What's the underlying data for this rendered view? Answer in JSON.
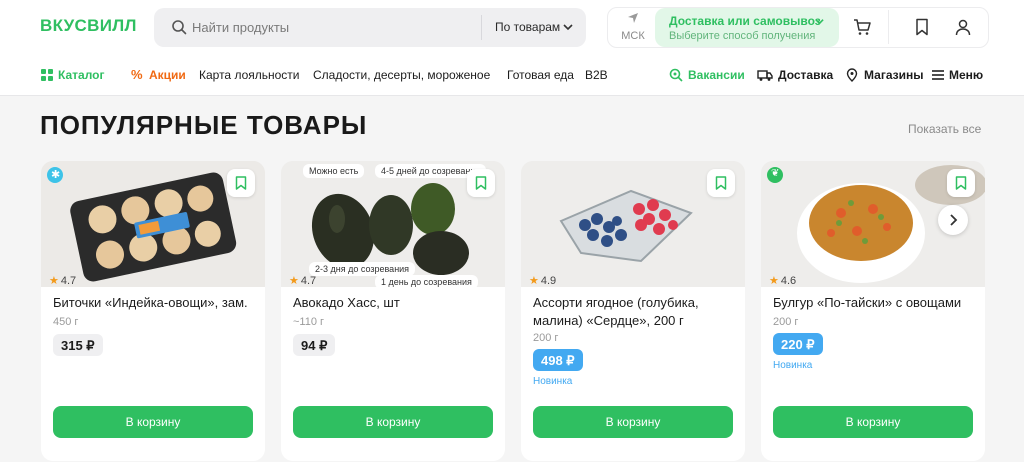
{
  "header": {
    "logo": "ВКУСВИЛЛ",
    "search": {
      "placeholder": "Найти продукты",
      "scope": "По товарам"
    },
    "city": "МСК",
    "delivery": {
      "title": "Доставка или самовывоз",
      "subtitle": "Выберите способ получения"
    },
    "icons": [
      "cart-icon",
      "bookmark-icon",
      "user-icon"
    ]
  },
  "nav": {
    "catalog": "Каталог",
    "promo": "Акции",
    "items": [
      "Карта лояльности",
      "Сладости, десерты, мороженое",
      "Готовая еда",
      "B2B"
    ],
    "jobs": "Вакансии",
    "delivery": "Доставка",
    "stores": "Магазины",
    "menu": "Меню"
  },
  "section": {
    "title": "Популярные товары",
    "show_all": "Показать все"
  },
  "products": [
    {
      "name": "Биточки «Индейка-овощи», зам.",
      "weight": "450 г",
      "price": "315 ₽",
      "rating": "4.7",
      "button": "В корзину"
    },
    {
      "name": "Авокадо Хасс, шт",
      "weight": "~110 г",
      "price": "94 ₽",
      "rating": "4.7",
      "button": "В корзину",
      "badges": [
        "Можно есть",
        "4-5 дней до созревания",
        "2-3 дня до созревания",
        "1 день до созревания"
      ]
    },
    {
      "name": "Ассорти ягодное (голубика, малина) «Сердце», 200 г",
      "weight": "200 г",
      "price": "498 ₽",
      "rating": "4.9",
      "tag": "Новинка",
      "button": "В корзину"
    },
    {
      "name": "Булгур «По-тайски» с овощами",
      "weight": "200 г",
      "price": "220 ₽",
      "rating": "4.6",
      "tag": "Новинка",
      "button": "В корзину"
    }
  ],
  "colors": {
    "brand_green": "#2fbf61",
    "promo_orange": "#f06a14",
    "new_blue": "#43a9f1"
  }
}
